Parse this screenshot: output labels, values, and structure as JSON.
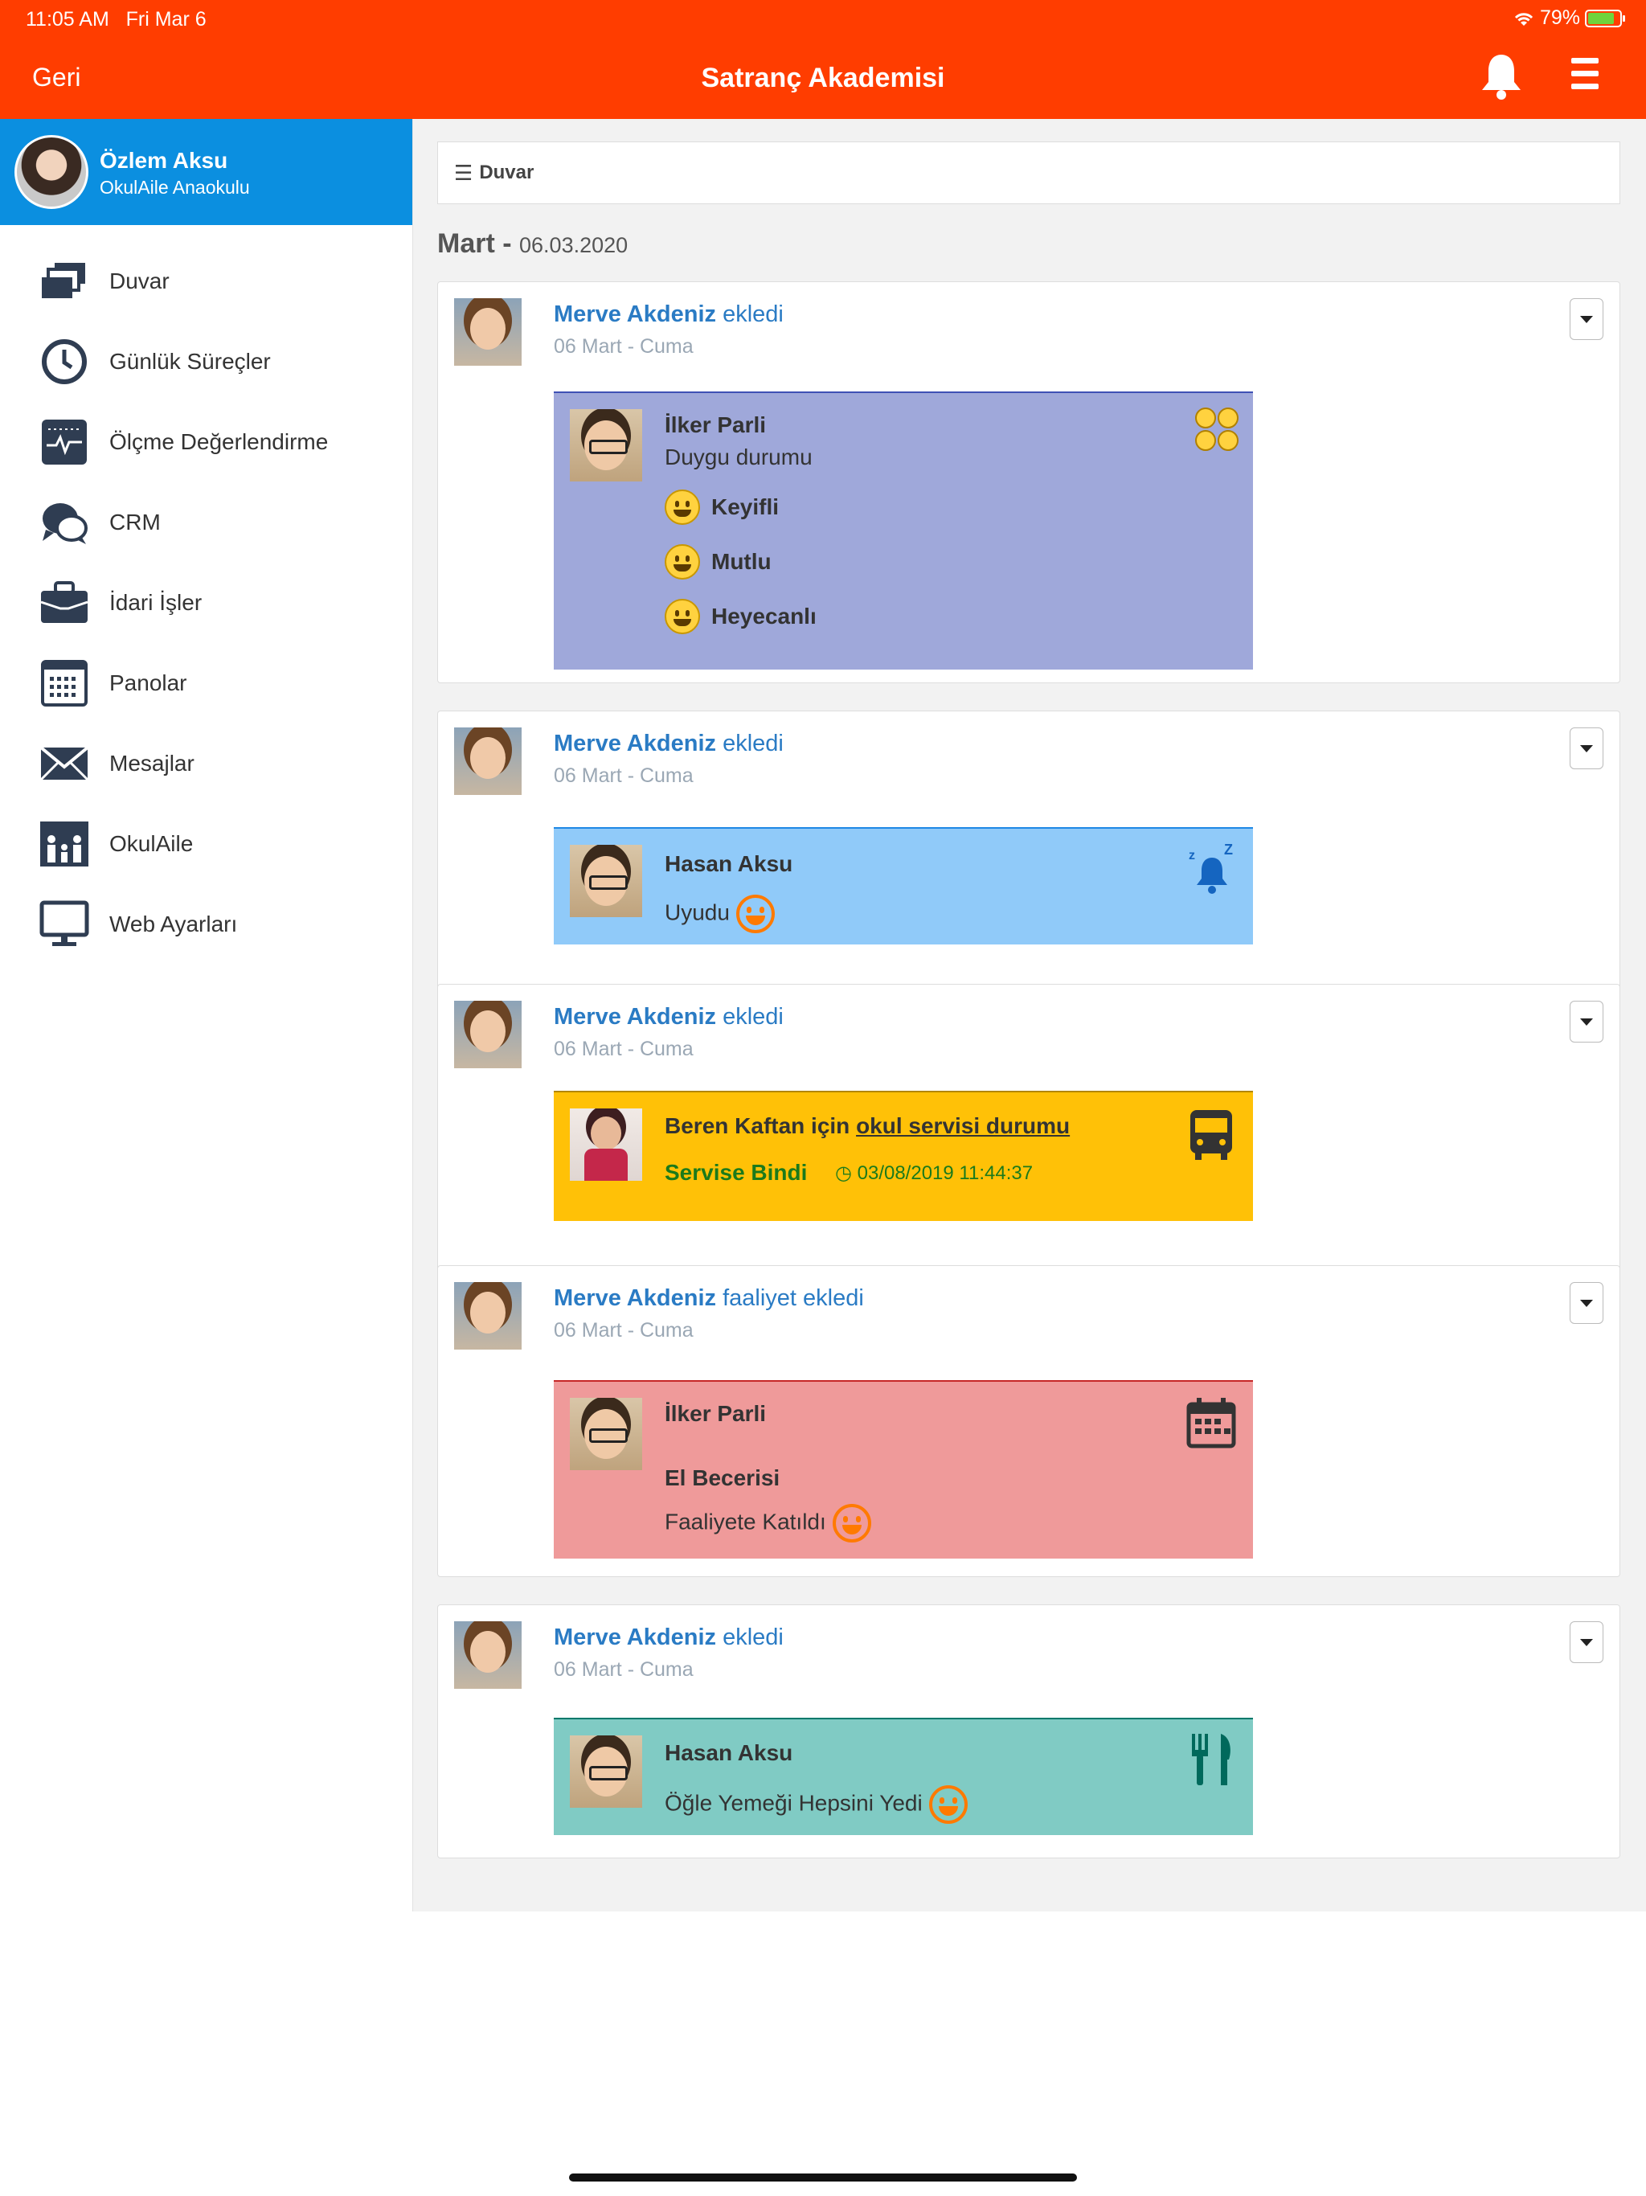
{
  "status_bar": {
    "time": "11:05 AM",
    "date": "Fri Mar 6",
    "battery": "79%"
  },
  "app_bar": {
    "back_label": "Geri",
    "title": "Satranç Akademisi"
  },
  "profile": {
    "name": "Özlem Aksu",
    "school": "OkulAile Anaokulu"
  },
  "sidebar": {
    "items": [
      {
        "label": "Duvar",
        "icon": "wall-icon"
      },
      {
        "label": "Günlük Süreçler",
        "icon": "clock-icon"
      },
      {
        "label": "Ölçme Değerlendirme",
        "icon": "pulse-icon"
      },
      {
        "label": "CRM",
        "icon": "chat-icon"
      },
      {
        "label": "İdari İşler",
        "icon": "briefcase-icon"
      },
      {
        "label": "Panolar",
        "icon": "board-icon"
      },
      {
        "label": "Mesajlar",
        "icon": "envelope-icon"
      },
      {
        "label": "OkulAile",
        "icon": "family-icon"
      },
      {
        "label": "Web Ayarları",
        "icon": "monitor-icon"
      }
    ]
  },
  "main": {
    "breadcrumb": "Duvar",
    "month": "Mart",
    "date": "06.03.2020",
    "posts": [
      {
        "author": "Merve Akdeniz",
        "action": "ekledi",
        "date": "06 Mart - Cuma",
        "student": "İlker Parli",
        "subtitle": "Duygu durumu",
        "moods": [
          "Keyifli",
          "Mutlu",
          "Heyecanlı"
        ],
        "color": "#9fa8da"
      },
      {
        "author": "Merve Akdeniz",
        "action": "ekledi",
        "date": "06 Mart - Cuma",
        "student": "Hasan Aksu",
        "status": "Uyudu",
        "color": "#90caf9"
      },
      {
        "author": "Merve Akdeniz",
        "action": "ekledi",
        "date": "06 Mart - Cuma",
        "title_prefix": "Beren Kaftan için",
        "title_link": "okul servisi durumu",
        "status": "Servise Bindi",
        "timestamp": "03/08/2019 11:44:37",
        "color": "#ffc107"
      },
      {
        "author": "Merve Akdeniz",
        "action": "faaliyet ekledi",
        "date": "06 Mart - Cuma",
        "student": "İlker Parli",
        "activity": "El Becerisi",
        "status": "Faaliyete Katıldı",
        "color": "#ef9a9a"
      },
      {
        "author": "Merve Akdeniz",
        "action": "ekledi",
        "date": "06 Mart - Cuma",
        "student": "Hasan Aksu",
        "status": "Öğle Yemeği Hepsini Yedi",
        "color": "#80cbc4"
      }
    ]
  }
}
